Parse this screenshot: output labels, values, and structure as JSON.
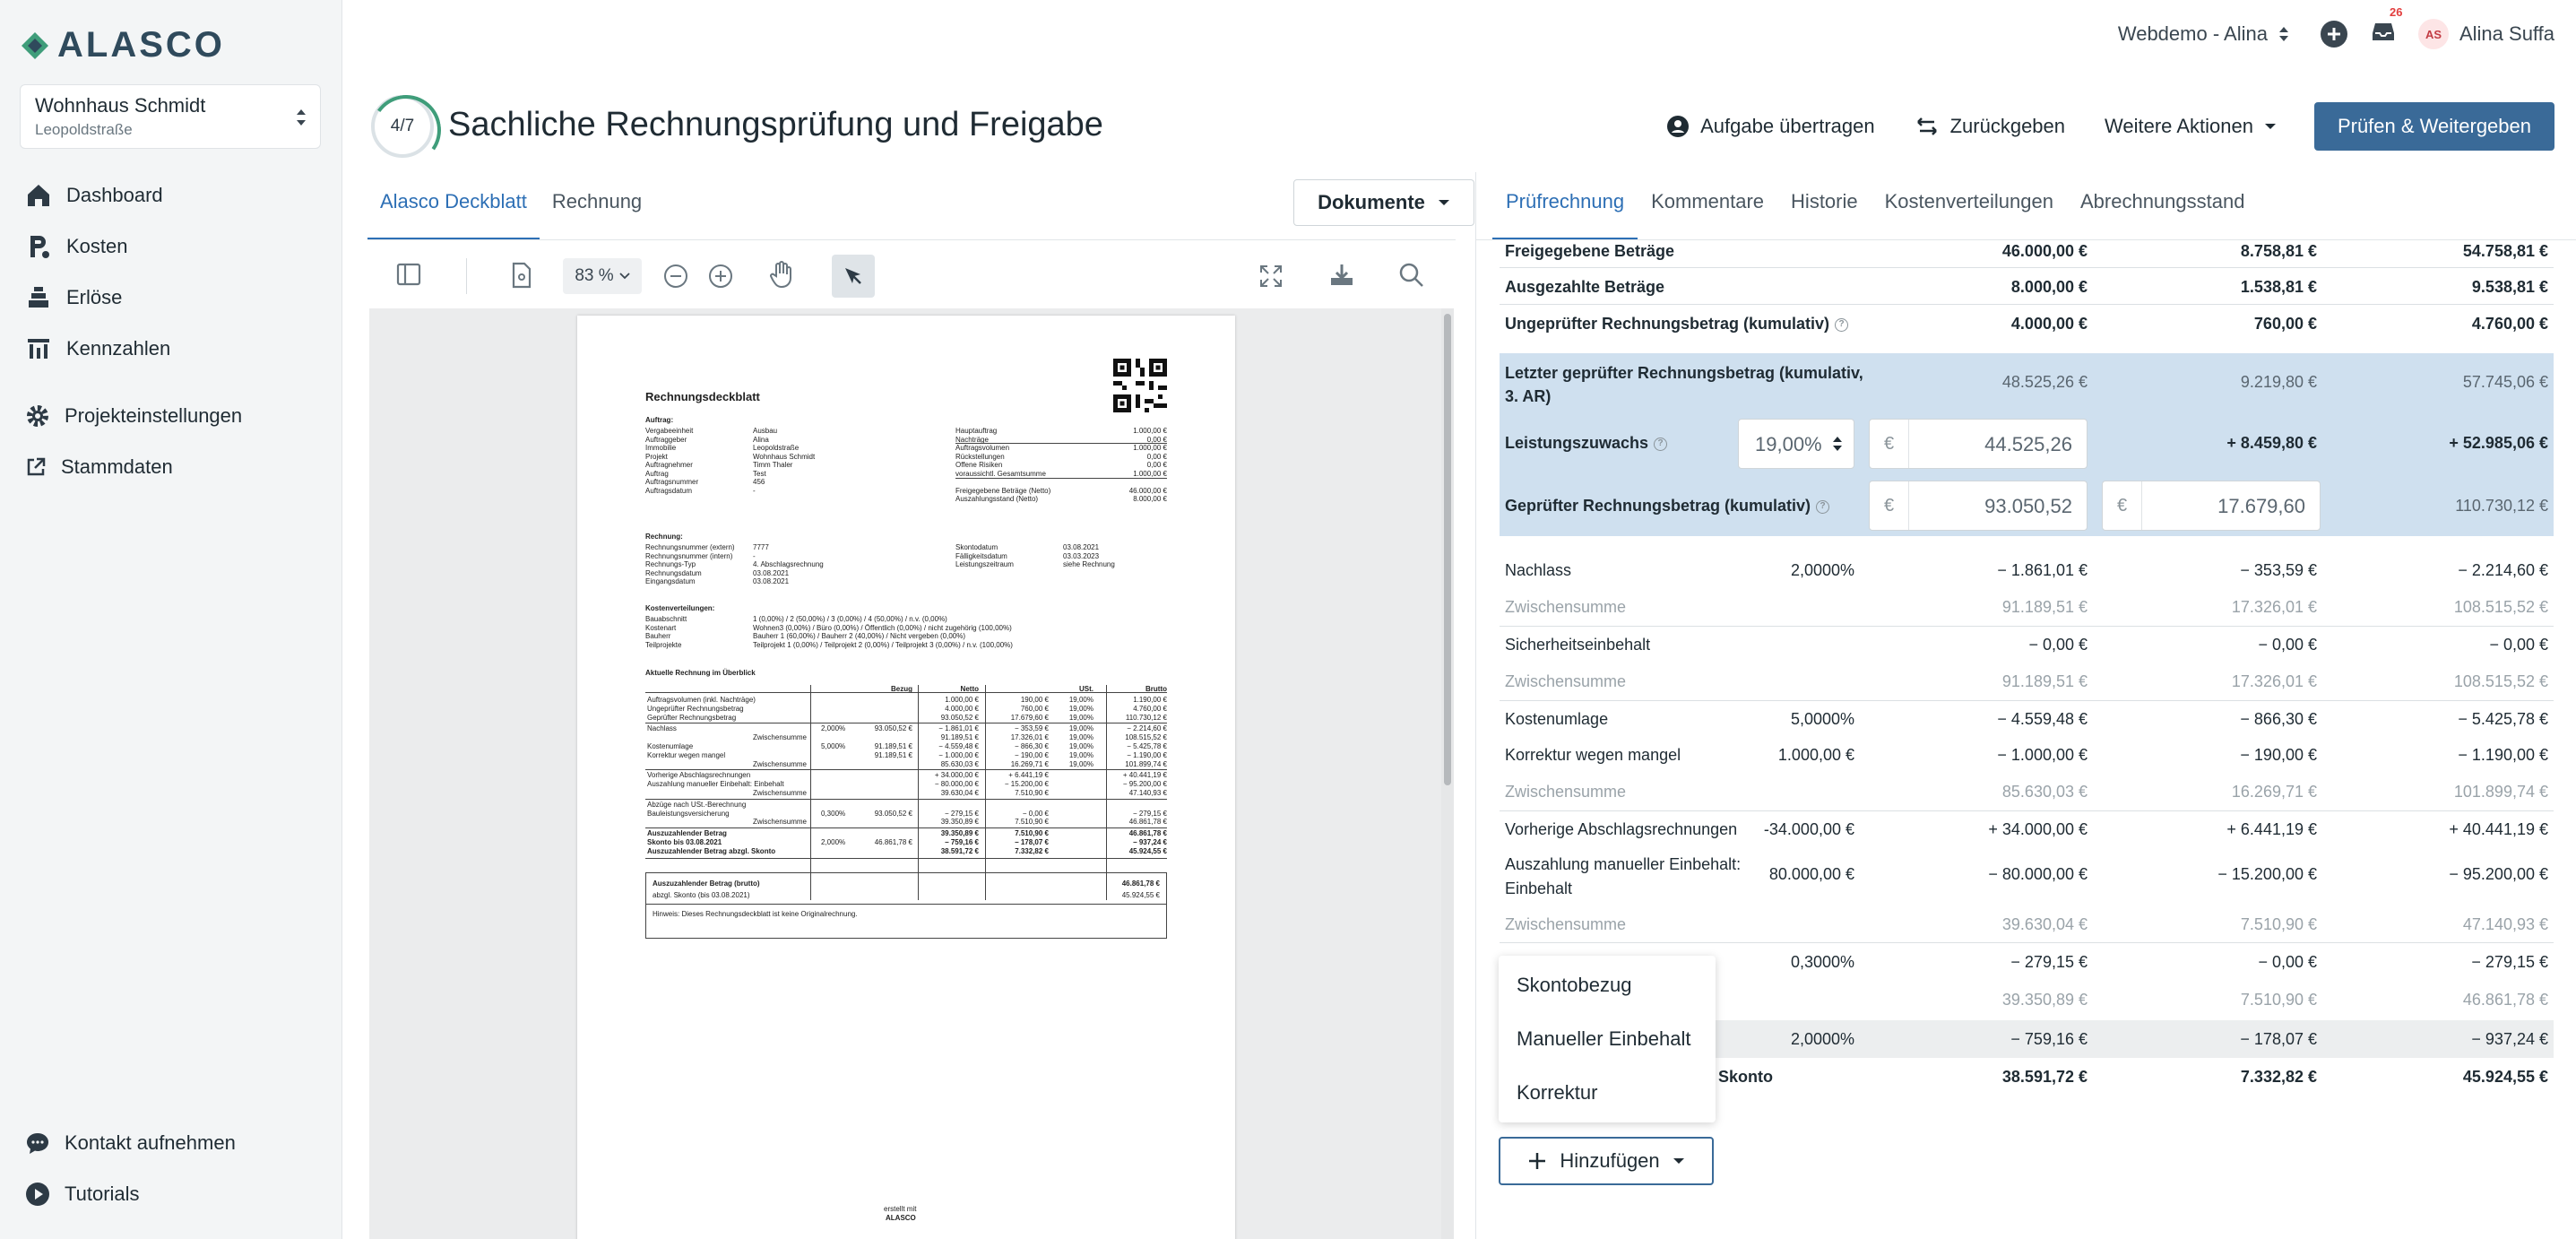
{
  "app": {
    "logo_text": "ALASCO"
  },
  "project": {
    "name": "Wohnhaus Schmidt",
    "street": "Leopoldstraße"
  },
  "nav": {
    "dashboard": "Dashboard",
    "kosten": "Kosten",
    "erloese": "Erlöse",
    "kennzahlen": "Kennzahlen",
    "projekteinstellungen": "Projekteinstellungen",
    "stammdaten": "Stammdaten",
    "kontakt": "Kontakt aufnehmen",
    "tutorials": "Tutorials"
  },
  "topbar": {
    "workspace": "Webdemo - Alina",
    "notifications": "26",
    "initials": "AS",
    "user": "Alina Suffa"
  },
  "task": {
    "step": "4/7",
    "title": "Sachliche Rechnungsprüfung und Freigabe"
  },
  "actions": {
    "transfer": "Aufgabe übertragen",
    "back": "Zurückgeben",
    "more": "Weitere Aktionen",
    "primary": "Prüfen & Weitergeben"
  },
  "left_tabs": {
    "deckblatt": "Alasco Deckblatt",
    "rechnung": "Rechnung",
    "documents": "Dokumente"
  },
  "viewer": {
    "zoom": "83 %"
  },
  "doc": {
    "title": "Rechnungsdeckblatt",
    "auftrag_h": "Auftrag:",
    "auftrag_left": [
      [
        "Vergabeeinheit",
        "Ausbau"
      ],
      [
        "Auftraggeber",
        "Alina"
      ],
      [
        "Immobilie",
        "Leopoldstraße"
      ],
      [
        "Projekt",
        "Wohnhaus Schmidt"
      ],
      [
        "Auftragnehmer",
        "Timm Thaler"
      ],
      [
        "Auftrag",
        "Test"
      ],
      [
        "Auftragsnummer",
        "456"
      ],
      [
        "Auftragsdatum",
        "-"
      ]
    ],
    "auftrag_right": [
      [
        "Hauptauftrag",
        "1.000,00 €"
      ],
      [
        "Nachträge",
        "0,00 €"
      ],
      [
        "Auftragsvolumen",
        "1.000,00 €"
      ],
      [
        "Rückstellungen",
        "0,00 €"
      ],
      [
        "Offene Risiken",
        "0,00 €"
      ],
      [
        "voraussichtl. Gesamtsumme",
        "1.000,00 €"
      ],
      [
        "",
        ""
      ],
      [
        "Freigegebene Beträge (Netto)",
        "46.000,00 €"
      ],
      [
        "Auszahlungsstand (Netto)",
        "8.000,00 €"
      ]
    ],
    "rechnung_h": "Rechnung:",
    "rechnung_left": [
      [
        "Rechnungsnummer (extern)",
        "7777"
      ],
      [
        "Rechnungsnummer (intern)",
        "-"
      ],
      [
        "Rechnungs-Typ",
        "4. Abschlagsrechnung"
      ],
      [
        "Rechnungsdatum",
        "03.08.2021"
      ],
      [
        "Eingangsdatum",
        "03.08.2021"
      ]
    ],
    "rechnung_right": [
      [
        "Skontodatum",
        "03.08.2021"
      ],
      [
        "Fälligkeitsdatum",
        "03.03.2023"
      ],
      [
        "Leistungszeitraum",
        "siehe Rechnung"
      ]
    ],
    "kv_h": "Kostenverteilungen:",
    "kv": [
      [
        "Bauabschnitt",
        "1 (0,00%) / 2 (50,00%) / 3 (0,00%) / 4 (50,00%) / n.v. (0,00%)"
      ],
      [
        "Kostenart",
        "Wohnen3 (0,00%) / Büro (0,00%) / Öffentlich (0,00%) / nicht zugehörig (100,00%)"
      ],
      [
        "Bauherr",
        "Bauherr 1 (60,00%) / Bauherr 2 (40,00%) / Nicht vergeben (0,00%)"
      ],
      [
        "Teilprojekte",
        "Teilprojekt 1 (0,00%) / Teilprojekt 2 (0,00%) / Teilprojekt 3 (0,00%) / n.v. (100,00%)"
      ]
    ],
    "ue_h": "Aktuelle Rechnung im Überblick",
    "table_head": [
      "Bezug",
      "Netto",
      "USt.",
      "Brutto"
    ],
    "table_rows": [
      [
        "Auftragsvolumen (inkl. Nachträge)",
        "",
        "",
        "1.000,00 €",
        "190,00 €",
        "19,00%",
        "1.190,00 €"
      ],
      [
        "Ungeprüfter Rechnungsbetrag",
        "",
        "",
        "4.000,00 €",
        "760,00 €",
        "19,00%",
        "4.760,00 €"
      ],
      [
        "Geprüfter Rechnungsbetrag",
        "",
        "",
        "93.050,52 €",
        "17.679,60 €",
        "19,00%",
        "110.730,12 €"
      ],
      [
        "Nachlass",
        "2,000%",
        "93.050,52 €",
        "− 1.861,01 €",
        "− 353,59 €",
        "19,00%",
        "− 2.214,60 €"
      ],
      [
        "Zwischensumme",
        "",
        "",
        "91.189,51 €",
        "17.326,01 €",
        "19,00%",
        "108.515,52 €"
      ],
      [
        "Kostenumlage",
        "5,000%",
        "91.189,51 €",
        "− 4.559,48 €",
        "− 866,30 €",
        "19,00%",
        "− 5.425,78 €"
      ],
      [
        "Korrektur wegen mangel",
        "",
        "91.189,51 €",
        "− 1.000,00 €",
        "− 190,00 €",
        "19,00%",
        "− 1.190,00 €"
      ],
      [
        "Zwischensumme",
        "",
        "",
        "85.630,03 €",
        "16.269,71 €",
        "19,00%",
        "101.899,74 €"
      ],
      [
        "Vorherige Abschlagsrechnungen",
        "",
        "",
        "+ 34.000,00 €",
        "+ 6.441,19 €",
        "",
        "+ 40.441,19 €"
      ],
      [
        "Auszahlung manueller Einbehalt: Einbehalt",
        "",
        "",
        "− 80.000,00 €",
        "− 15.200,00 €",
        "",
        "− 95.200,00 €"
      ],
      [
        "Zwischensumme",
        "",
        "",
        "39.630,04 €",
        "7.510,90 €",
        "",
        "47.140,93 €"
      ],
      [
        "Abzüge nach USt.-Berechnung",
        "",
        "",
        "",
        "",
        "",
        ""
      ],
      [
        "Bauleistungsversicherung",
        "0,300%",
        "93.050,52 €",
        "− 279,15 €",
        "− 0,00 €",
        "",
        "− 279,15 €"
      ],
      [
        "Zwischensumme",
        "",
        "",
        "39.350,89 €",
        "7.510,90 €",
        "",
        "46.861,78 €"
      ],
      [
        "Auszuzahlender Betrag",
        "",
        "",
        "39.350,89 €",
        "7.510,90 €",
        "",
        "46.861,78 €"
      ],
      [
        "Skonto bis 03.08.2021",
        "2,000%",
        "46.861,78 €",
        "− 759,16 €",
        "− 178,07 €",
        "",
        "− 937,24 €"
      ],
      [
        "Auszuzahlender Betrag abzgl. Skonto",
        "",
        "",
        "38.591,72 €",
        "7.332,82 €",
        "",
        "45.924,55 €"
      ]
    ],
    "box": [
      [
        "Auszuzahlender Betrag (brutto)",
        "46.861,78 €"
      ],
      [
        "abzgl. Skonto (bis 03.08.2021)",
        "45.924,55 €"
      ]
    ],
    "box_note": "Hinweis: Dieses Rechnungsdeckblatt ist keine Originalrechnung.",
    "footer_small": "erstellt mit",
    "footer_logo": "ALASCO"
  },
  "right_tabs": {
    "pruef": "Prüfrechnung",
    "kommentare": "Kommentare",
    "historie": "Historie",
    "kv": "Kostenverteilungen",
    "abrechnung": "Abrechnungsstand"
  },
  "calc": {
    "freigegeben": {
      "label": "Freigegebene Beträge",
      "netto": "46.000,00 €",
      "ust": "8.758,81 €",
      "brutto": "54.758,81 €"
    },
    "ausgezahlt": {
      "label": "Ausgezahlte Beträge",
      "netto": "8.000,00 €",
      "ust": "1.538,81 €",
      "brutto": "9.538,81 €"
    },
    "ungeprueft": {
      "label": "Ungeprüfter Rechnungsbetrag (kumulativ)",
      "netto": "4.000,00 €",
      "ust": "760,00 €",
      "brutto": "4.760,00 €"
    },
    "letzter": {
      "label1": "Letzter geprüfter Rechnungsbetrag (kumulativ,",
      "label2": "3. AR)",
      "netto": "48.525,26 €",
      "ust": "9.219,80 €",
      "brutto": "57.745,06 €"
    },
    "leistung": {
      "label": "Leistungszuwachs",
      "rate": "19,00%",
      "currency": "€",
      "netto": "44.525,26",
      "ust": "+ 8.459,80 €",
      "brutto": "+ 52.985,06 €"
    },
    "geprueft": {
      "label": "Geprüfter Rechnungsbetrag (kumulativ)",
      "currency": "€",
      "netto": "93.050,52",
      "ust": "17.679,60",
      "brutto": "110.730,12 €"
    },
    "nachlass": {
      "label": "Nachlass",
      "bezug": "2,0000%",
      "netto": "− 1.861,01 €",
      "ust": "− 353,59 €",
      "brutto": "− 2.214,60 €"
    },
    "zs1": {
      "label": "Zwischensumme",
      "netto": "91.189,51 €",
      "ust": "17.326,01 €",
      "brutto": "108.515,52 €"
    },
    "sicherheit": {
      "label": "Sicherheitseinbehalt",
      "netto": "− 0,00 €",
      "ust": "− 0,00 €",
      "brutto": "− 0,00 €"
    },
    "zs2": {
      "label": "Zwischensumme",
      "netto": "91.189,51 €",
      "ust": "17.326,01 €",
      "brutto": "108.515,52 €"
    },
    "umlage": {
      "label": "Kostenumlage",
      "bezug": "5,0000%",
      "netto": "− 4.559,48 €",
      "ust": "− 866,30 €",
      "brutto": "− 5.425,78 €"
    },
    "korrektur": {
      "label": "Korrektur wegen mangel",
      "bezug": "1.000,00 €",
      "netto": "− 1.000,00 €",
      "ust": "− 190,00 €",
      "brutto": "− 1.190,00 €"
    },
    "zs3": {
      "label": "Zwischensumme",
      "netto": "85.630,03 €",
      "ust": "16.269,71 €",
      "brutto": "101.899,74 €"
    },
    "vorherige": {
      "label": "Vorherige Abschlagsrechnungen",
      "bezug": "-34.000,00 €",
      "netto": "+ 34.000,00 €",
      "ust": "+ 6.441,19 €",
      "brutto": "+ 40.441,19 €"
    },
    "auszahlung": {
      "label1": "Auszahlung manueller Einbehalt:",
      "label2": "Einbehalt",
      "bezug": "80.000,00 €",
      "netto": "− 80.000,00 €",
      "ust": "− 15.200,00 €",
      "brutto": "− 95.200,00 €"
    },
    "zs4": {
      "label": "Zwischensumme",
      "netto": "39.630,04 €",
      "ust": "7.510,90 €",
      "brutto": "47.140,93 €"
    },
    "bauleistung": {
      "bezug": "0,3000%",
      "netto": "− 279,15 €",
      "ust": "− 0,00 €",
      "brutto": "− 279,15 €"
    },
    "zs5": {
      "netto": "39.350,89 €",
      "ust": "7.510,90 €",
      "brutto": "46.861,78 €"
    },
    "skonto": {
      "bezug": "2,0000%",
      "netto": "− 759,16 €",
      "ust": "− 178,07 €",
      "brutto": "− 937,24 €"
    },
    "final": {
      "label": "Skonto",
      "netto": "38.591,72 €",
      "ust": "7.332,82 €",
      "brutto": "45.924,55 €"
    }
  },
  "add_menu": {
    "items": [
      "Skontobezug",
      "Manueller Einbehalt",
      "Korrektur"
    ],
    "button": "Hinzufügen"
  },
  "colors": {
    "primary": "#3a6a98",
    "accent_tab": "#2d6fb5",
    "highlight_rows": "#cfe0ef",
    "sidebar_bg": "#f3f5f6"
  }
}
